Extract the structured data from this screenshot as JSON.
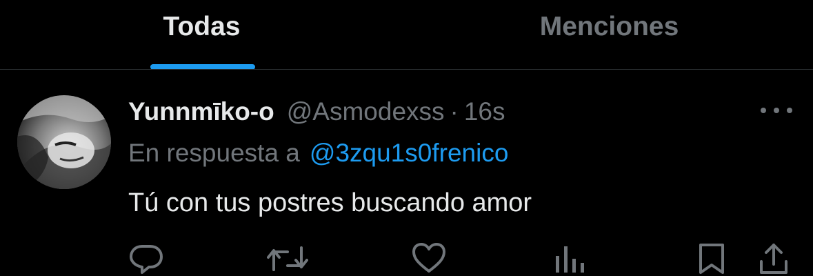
{
  "tabs": [
    {
      "label": "Todas",
      "selected": true
    },
    {
      "label": "Menciones",
      "selected": false
    }
  ],
  "colors": {
    "background": "#000000",
    "accent": "#1d9bf0",
    "text_primary": "#e7e9ea",
    "text_secondary": "#71767b",
    "divider": "#2f3336"
  },
  "tweet": {
    "display_name": "Yunnmīko-o",
    "handle": "@Asmodexss",
    "separator": "·",
    "time": "16s",
    "reply_prefix": "En respuesta a",
    "reply_to": "@3zqu1s0frenico",
    "text": "Tú con tus postres buscando amor",
    "icons": {
      "more": "more-horizontal-icon",
      "reply": "reply-icon",
      "retweet": "retweet-icon",
      "like": "heart-icon",
      "views": "analytics-icon",
      "bookmark": "bookmark-icon",
      "share": "share-icon"
    }
  }
}
